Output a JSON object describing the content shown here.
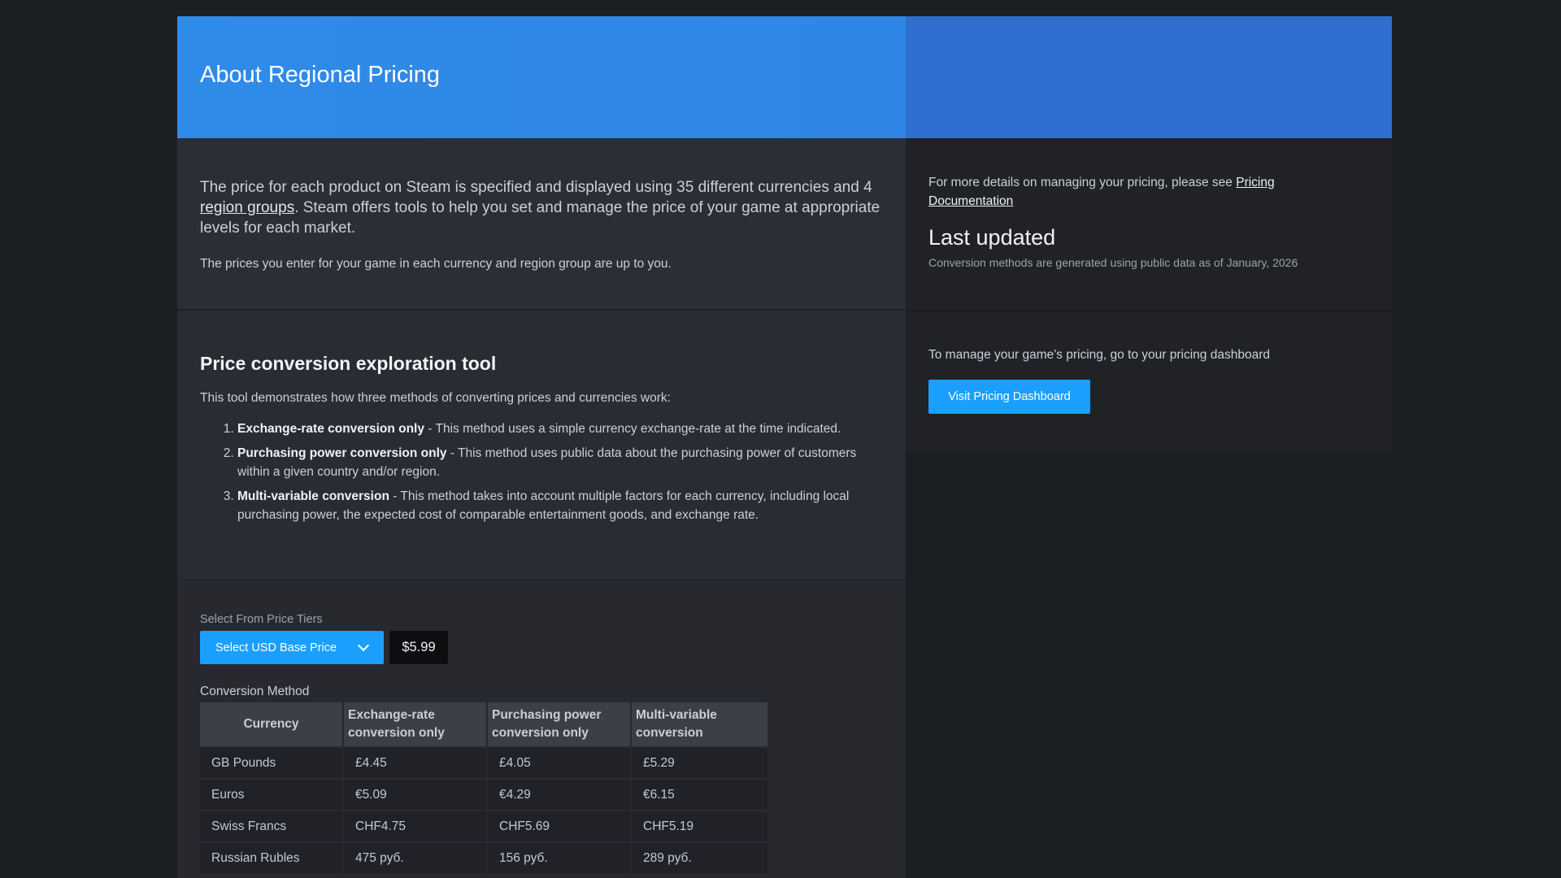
{
  "header": {
    "title": "About Regional Pricing"
  },
  "intro": {
    "p1_before": "The price for each product on Steam is specified and displayed using 35 different currencies and 4 ",
    "p1_link": "region groups",
    "p1_after": ". Steam offers tools to help you set and manage the price of your game at appropriate levels for each market.",
    "p2": "The prices you enter for your game in each currency and region group are up to you."
  },
  "tool": {
    "title": "Price conversion exploration tool",
    "description": "This tool demonstrates how three methods of converting prices and currencies work:",
    "methods": [
      {
        "name": "Exchange-rate conversion only",
        "text": " - This method uses a simple currency exchange-rate at the time indicated."
      },
      {
        "name": "Purchasing power conversion only",
        "text": " - This method uses public data about the purchasing power of customers within a given country and/or region."
      },
      {
        "name": "Multi-variable conversion",
        "text": " - This method takes into account multiple factors for each currency, including local purchasing power, the expected cost of comparable entertainment goods, and exchange rate."
      }
    ]
  },
  "selector": {
    "tier_label": "Select From Price Tiers",
    "select_button": "Select USD Base Price",
    "base_price": "$5.99",
    "method_label": "Conversion Method"
  },
  "table": {
    "headers": [
      "Currency",
      "Exchange-rate conversion only",
      "Purchasing power conversion only",
      "Multi-variable conversion"
    ],
    "rows": [
      [
        "GB Pounds",
        "£4.45",
        "£4.05",
        "£5.29"
      ],
      [
        "Euros",
        "€5.09",
        "€4.29",
        "€6.15"
      ],
      [
        "Swiss Francs",
        "CHF4.75",
        "CHF5.69",
        "CHF5.19"
      ],
      [
        "Russian Rubles",
        "475 руб.",
        "156 руб.",
        "289 руб."
      ]
    ]
  },
  "sidebar": {
    "doc_text": "For more details on managing your pricing, please see ",
    "doc_link": "Pricing Documentation",
    "last_updated_title": "Last updated",
    "last_updated_desc": "Conversion methods are generated using public data as of January, 2026",
    "manage_text": "To manage your game's pricing, go to your pricing dashboard",
    "dashboard_button": "Visit Pricing Dashboard"
  },
  "colors": {
    "accent_blue": "#1a9fff",
    "header_blue": "#2f8be8",
    "background": "#1b1e23"
  }
}
